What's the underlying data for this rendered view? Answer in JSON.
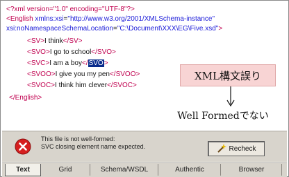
{
  "editor": {
    "lines": {
      "l1": {
        "a": "<?xml version=\"1.0\" encoding=\"UTF-8\"?>"
      },
      "l2": {
        "tag": "<English",
        "attr": " xmlns:xsi",
        "eq": "=",
        "val": "\"http://www.w3.org/2001/XMLSchema-instance\""
      },
      "l3": {
        "attr": "xsi:noNamespaceSchemaLocation",
        "eq": "=",
        "val": "\"C:\\Document\\XXX\\EG\\Five.xsd\"",
        "close": ">"
      },
      "l4": {
        "o": "<SV>",
        "t": "I think",
        "c": "</SV>"
      },
      "l5": {
        "o": "<SVO>",
        "t": "I go to school",
        "c": "</SVO>"
      },
      "l6": {
        "o": "<SVC>",
        "t": "I am a boy",
        "c1": "</",
        "sel": "SVO",
        "c2": ">"
      },
      "l7": {
        "o": "<SVOO>",
        "t": "I give you my pen",
        "c": "</SVOO>"
      },
      "l8": {
        "o": "<SVOC>",
        "t": "I think him clever",
        "c": "</SVOC>"
      },
      "l9": {
        "a": "</English>"
      }
    }
  },
  "callout": {
    "box_label": "XML構文誤り",
    "arrow_glyph": "↓",
    "caption": "Well Formedでない"
  },
  "status": {
    "message_line1": "This file is not well-formed:",
    "message_line2": "SVC closing element name expected.",
    "recheck_label": "Recheck"
  },
  "tabs": [
    "Text",
    "Grid",
    "Schema/WSDL",
    "Authentic",
    "Browser"
  ],
  "colors": {
    "tag": "#c0004f",
    "attribute": "#1a1ad8",
    "selection": "#0a2c8c",
    "callout_bg": "#f8d4d4",
    "error_red": "#d61f1f"
  },
  "icons": {
    "error": "error-x-icon",
    "recheck": "recheck-wand-icon",
    "arrow": "down-arrow-icon"
  }
}
